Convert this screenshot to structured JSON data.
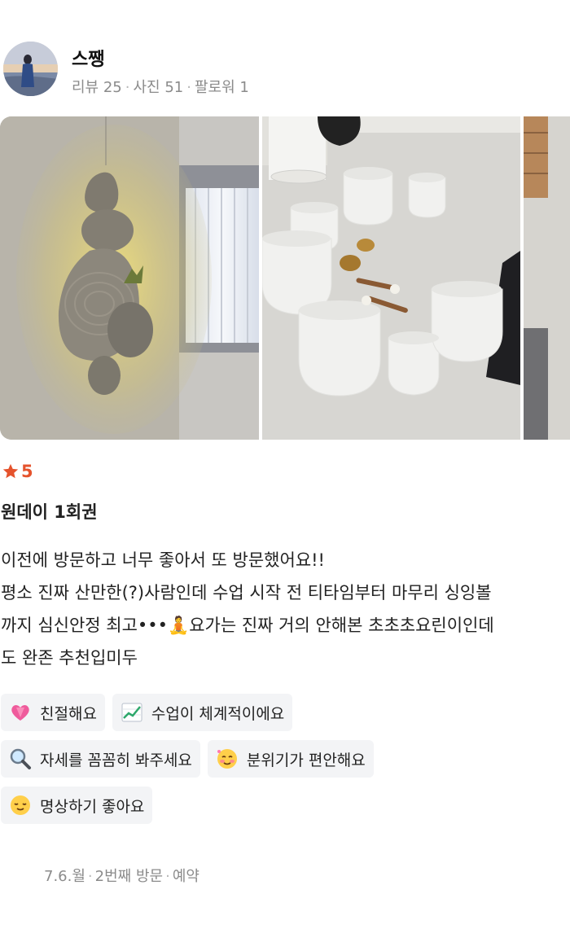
{
  "user": {
    "name": "스쨍",
    "stats": [
      "리뷰 25",
      "사진 51",
      "팔로워 1"
    ]
  },
  "photos": [
    {
      "subject": "backlit stone wall art"
    },
    {
      "subject": "crystal singing bowls on floor"
    },
    {
      "subject": "partial wooden shelf"
    }
  ],
  "review": {
    "rating": "5",
    "rating_color": "#e5532d",
    "title": "원데이 1회권",
    "lines": [
      "이전에 방문하고 너무 좋아서 또 방문했어요!!",
      "평소 진짜 산만한(?)사람인데 수업 시작 전 티타임부터 마무리 싱잉볼",
      "까지 심신안정 최고•••🧘요가는 진짜 거의 안해본 초초초요린이인데",
      "도 완존 추천입미두"
    ]
  },
  "keywords": [
    {
      "icon": "heart-icon",
      "label": "친절해요"
    },
    {
      "icon": "chart-icon",
      "label": "수업이 체계적이에요"
    },
    {
      "icon": "magnifier-icon",
      "label": "자세를 꼼꼼히 봐주세요"
    },
    {
      "icon": "smile-blush-icon",
      "label": "분위기가 편안해요"
    },
    {
      "icon": "relieved-face-icon",
      "label": "명상하기 좋아요"
    }
  ],
  "visit": {
    "date": "7.6.월",
    "visit_count": "2번째 방문",
    "type": "예약"
  }
}
